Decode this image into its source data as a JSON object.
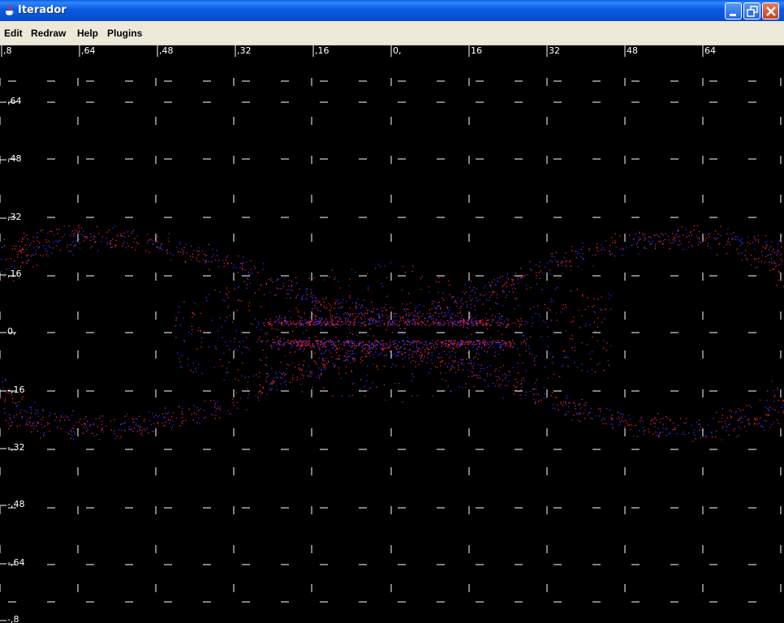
{
  "window": {
    "title": "Iterador",
    "icon": "java-cup-icon",
    "controls": [
      "minimize-icon",
      "restore-icon",
      "close-icon"
    ]
  },
  "menu": {
    "items": [
      {
        "label": "Edit"
      },
      {
        "label": "Redraw"
      },
      {
        "label": "Help"
      },
      {
        "label": "Plugins"
      }
    ]
  },
  "plot": {
    "background": "#000000",
    "axis_color": "#ffffff",
    "point_colors": [
      "#ff2020",
      "#3030ff"
    ],
    "x_tick_labels": [
      ",8",
      ",64",
      ",48",
      ",32",
      ",16",
      "0,",
      "16",
      "32",
      "48",
      "64"
    ],
    "y_tick_labels": [
      ",64",
      ",48",
      ",32",
      ",16",
      "0,",
      "-,16",
      "-,32",
      "-,48",
      "-,64",
      "-,8"
    ]
  }
}
